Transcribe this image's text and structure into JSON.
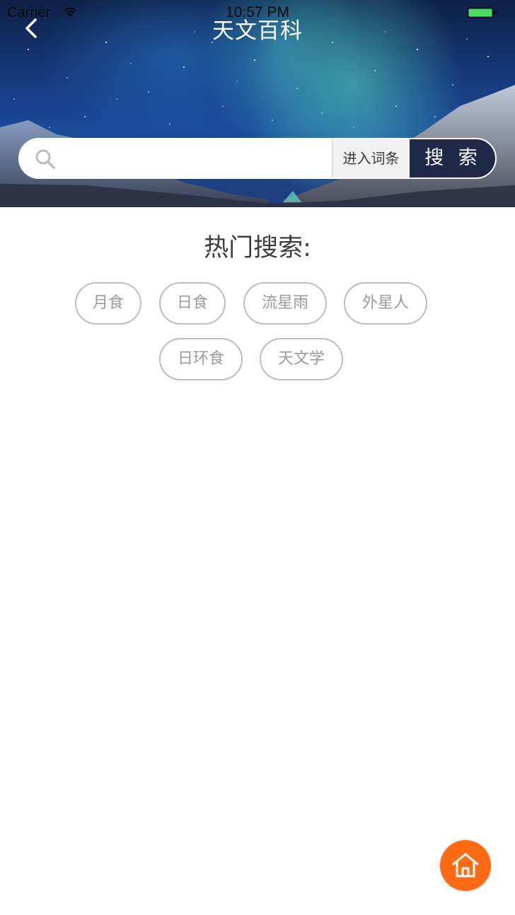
{
  "status_bar": {
    "carrier": "Carrier",
    "time": "10:57 PM",
    "icons": [
      "wifi-icon",
      "battery-icon"
    ]
  },
  "nav": {
    "title": "天文百科",
    "back_icon": "chevron-left-icon"
  },
  "search": {
    "placeholder": "",
    "value": "",
    "icon": "search-icon",
    "mode_label": "进入词条",
    "button_label": "搜 索"
  },
  "hot": {
    "title": "热门搜索:",
    "tags": [
      "月食",
      "日食",
      "流星雨",
      "外星人",
      "日环食",
      "天文学"
    ]
  },
  "home_button": {
    "icon": "home-icon"
  },
  "colors": {
    "accent": "#ff6a14",
    "search_button": "#1f2a4a",
    "tag_border": "#bdbdbd",
    "tag_text": "#9a9a9a",
    "title_text": "#3d3d3d",
    "battery": "#4cd964"
  }
}
